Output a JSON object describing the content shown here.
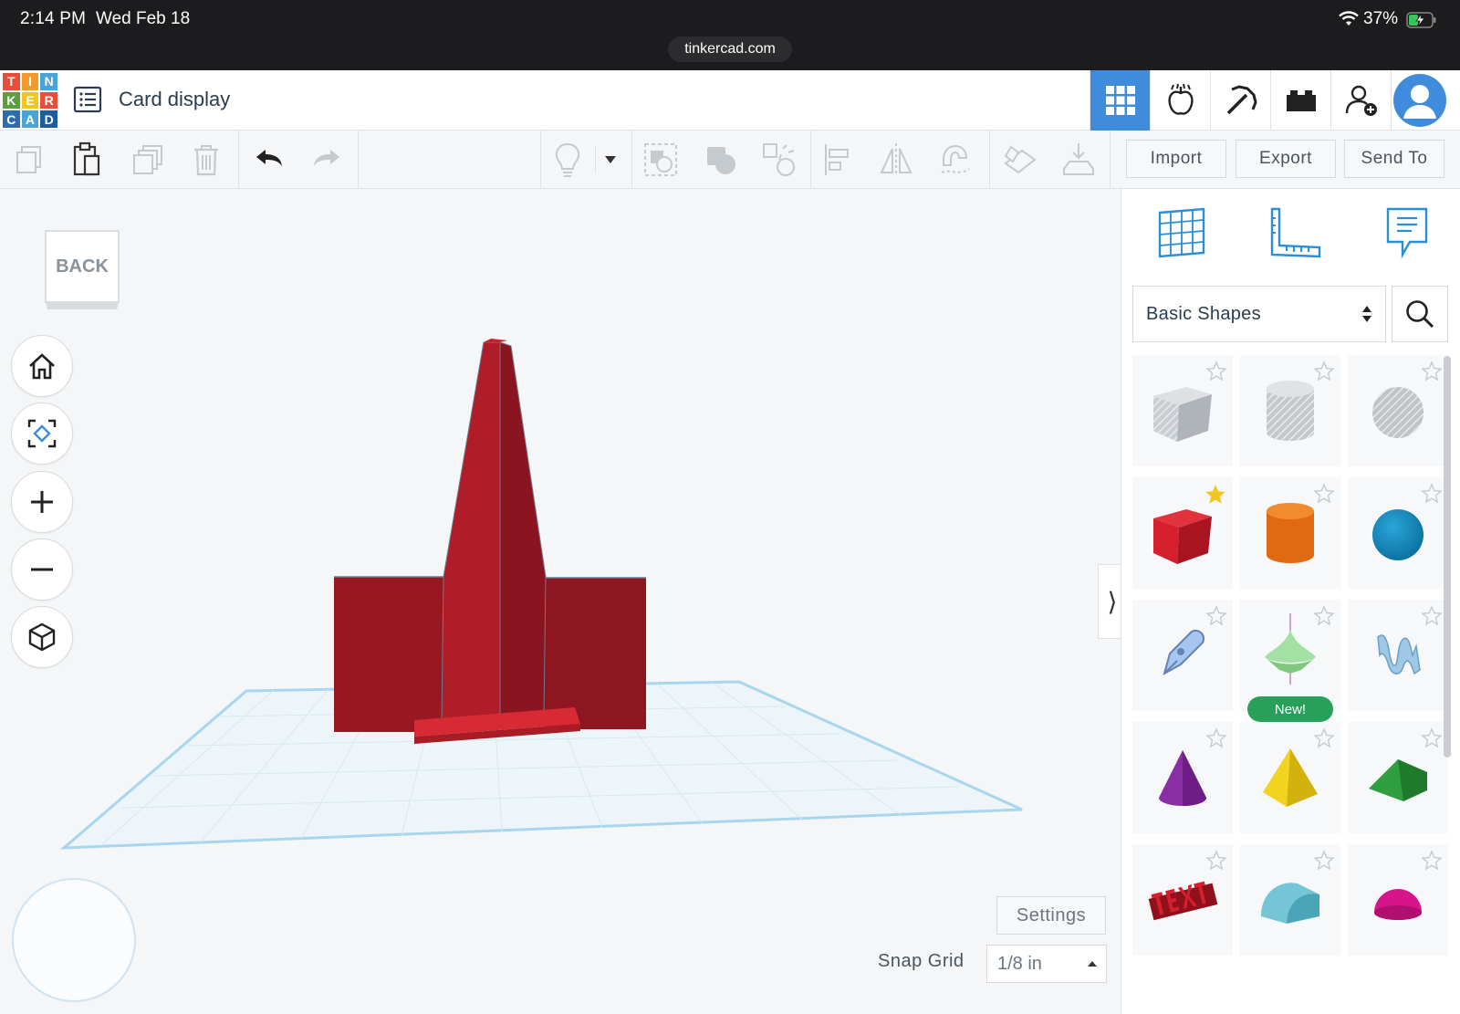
{
  "status_bar": {
    "time": "2:14 PM",
    "date": "Wed Feb 18",
    "url": "tinkercad.com",
    "battery": "37%"
  },
  "header": {
    "logo_letters": [
      "T",
      "I",
      "N",
      "K",
      "E",
      "R",
      "C",
      "A",
      "D"
    ],
    "design_title": "Card display",
    "accent_color": "#3e8cdb"
  },
  "toolbar": {
    "import_label": "Import",
    "export_label": "Export",
    "send_to_label": "Send To"
  },
  "viewport": {
    "viewcube_label": "BACK",
    "settings_label": "Settings",
    "snap_grid_label": "Snap Grid",
    "snap_grid_value": "1/8 in",
    "object_color": "#c8202b"
  },
  "panel": {
    "shape_category": "Basic Shapes",
    "shapes": [
      {
        "name": "Box (hole)",
        "icon": "box-hole",
        "favorite": false
      },
      {
        "name": "Cylinder (hole)",
        "icon": "cylinder-hole",
        "favorite": false
      },
      {
        "name": "Sphere (hole)",
        "icon": "sphere-hole",
        "favorite": false
      },
      {
        "name": "Box",
        "icon": "box",
        "favorite": true
      },
      {
        "name": "Cylinder",
        "icon": "cylinder",
        "favorite": false
      },
      {
        "name": "Sphere",
        "icon": "sphere",
        "favorite": false
      },
      {
        "name": "Scribble",
        "icon": "scribble",
        "favorite": false
      },
      {
        "name": "Spinning top",
        "icon": "spinner",
        "favorite": false,
        "badge": "New!"
      },
      {
        "name": "Shape generator",
        "icon": "wave",
        "favorite": false
      },
      {
        "name": "Cone",
        "icon": "cone",
        "favorite": false
      },
      {
        "name": "Pyramid",
        "icon": "pyramid",
        "favorite": false
      },
      {
        "name": "Roof",
        "icon": "roof",
        "favorite": false
      },
      {
        "name": "Text",
        "icon": "text",
        "favorite": false
      },
      {
        "name": "Half cylinder",
        "icon": "half-cylinder",
        "favorite": false
      },
      {
        "name": "Half sphere",
        "icon": "half-sphere",
        "favorite": false
      }
    ]
  }
}
